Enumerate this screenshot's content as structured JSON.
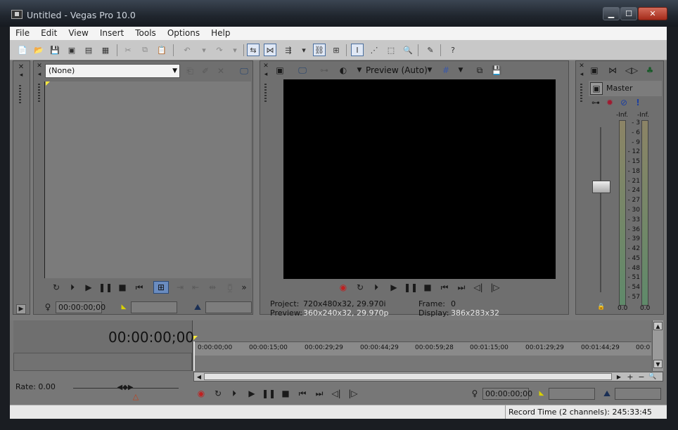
{
  "window": {
    "title": "Untitled - Vegas Pro 10.0",
    "minimize": "▁",
    "maximize": "☐",
    "close": "✕"
  },
  "menu": {
    "items": [
      "File",
      "Edit",
      "View",
      "Insert",
      "Tools",
      "Options",
      "Help"
    ]
  },
  "trimmer": {
    "dropdown_value": "(None)",
    "timecode": "00:00:00;00"
  },
  "preview": {
    "mode_label": "Preview (Auto)",
    "project_label": "Project:",
    "project_value": "720x480x32, 29.970i",
    "preview_label": "Preview:",
    "preview_value": "360x240x32, 29.970p",
    "frame_label": "Frame:",
    "frame_value": "0",
    "display_label": "Display:",
    "display_value": "386x283x32"
  },
  "mixer": {
    "master_label": "Master",
    "peak_left": "-Inf.",
    "peak_right": "-Inf.",
    "scale": [
      "3",
      "6",
      "9",
      "12",
      "15",
      "18",
      "21",
      "24",
      "27",
      "30",
      "33",
      "36",
      "39",
      "42",
      "45",
      "48",
      "51",
      "54",
      "57"
    ],
    "level_left": "0.0",
    "level_right": "0.0"
  },
  "timeline": {
    "cursor_time": "00:00:00;00",
    "rate": "Rate: 0.00",
    "ruler": [
      "0:00:00;00",
      "00:00:15;00",
      "00:00:29;29",
      "00:00:44;29",
      "00:00:59;28",
      "00:01:15;00",
      "00:01:29;29",
      "00:01:44;29",
      "00:0"
    ],
    "transport_time": "00:00:00;00"
  },
  "status": {
    "record_time": "Record Time (2 channels): 245:33:45"
  }
}
